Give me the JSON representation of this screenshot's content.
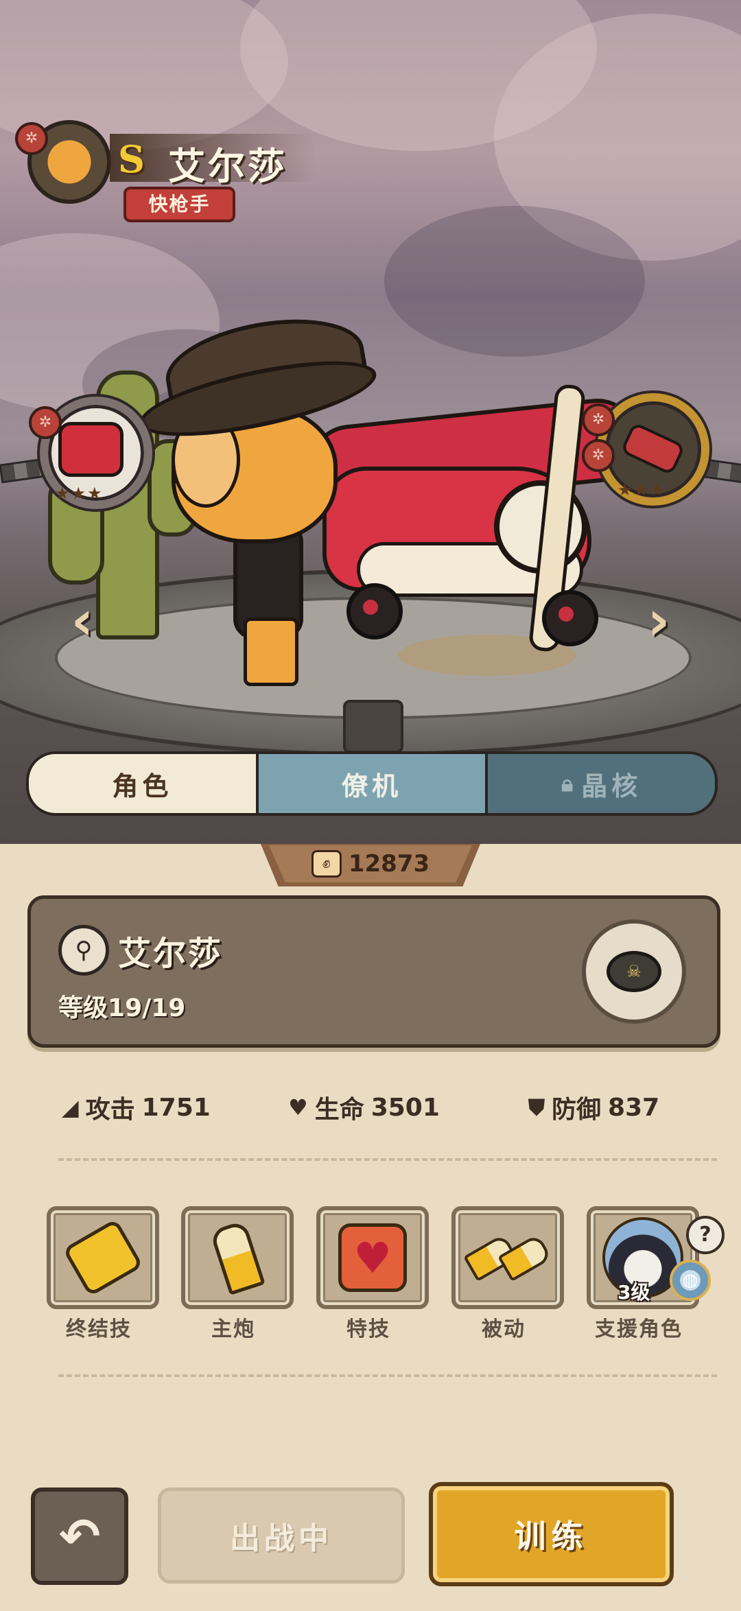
{
  "header": {
    "rank": "S",
    "character_name": "艾尔莎",
    "role": "快枪手"
  },
  "tabs": [
    {
      "label": "角色",
      "state": "selected"
    },
    {
      "label": "僚机",
      "state": "normal"
    },
    {
      "label": "晶核",
      "state": "locked"
    }
  ],
  "power": {
    "value": "12873"
  },
  "character_panel": {
    "name": "艾尔莎",
    "level_label": "等级",
    "level": "19/19"
  },
  "stats": [
    {
      "label": "攻击",
      "value": "1751",
      "icon": "bullet-icon"
    },
    {
      "label": "生命",
      "value": "3501",
      "icon": "heart-icon"
    },
    {
      "label": "防御",
      "value": "837",
      "icon": "shield-icon"
    }
  ],
  "skills": [
    {
      "label": "终结技",
      "icon": "gatling-gun-icon"
    },
    {
      "label": "主炮",
      "icon": "bullet-icon"
    },
    {
      "label": "特技",
      "icon": "heart-icon"
    },
    {
      "label": "被动",
      "icon": "double-bullet-icon"
    },
    {
      "label": "支援角色",
      "icon": "support-character-icon",
      "level": "3级"
    }
  ],
  "buttons": {
    "deploy": "出战中",
    "train": "训练"
  },
  "colors": {
    "accent_gold": "#e1a628",
    "tab_selected": "#f3ead6",
    "tab_plane": "#7ea3b0",
    "tab_locked": "#52707b",
    "panel": "#7d6e5e"
  }
}
